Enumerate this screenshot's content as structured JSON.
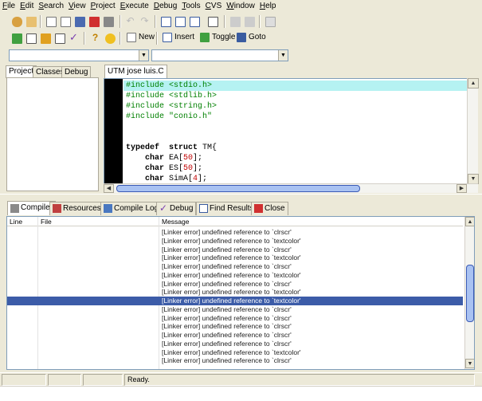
{
  "menu": [
    {
      "key": "F",
      "rest": "ile"
    },
    {
      "key": "E",
      "rest": "dit"
    },
    {
      "key": "S",
      "rest": "earch"
    },
    {
      "key": "V",
      "rest": "iew"
    },
    {
      "key": "P",
      "rest": "roject"
    },
    {
      "key": "E",
      "rest": "xecute"
    },
    {
      "key": "D",
      "rest": "ebug"
    },
    {
      "key": "T",
      "rest": "ools"
    },
    {
      "key": "C",
      "rest": "VS"
    },
    {
      "key": "W",
      "rest": "indow"
    },
    {
      "key": "H",
      "rest": "elp"
    }
  ],
  "toolbar2": {
    "new": "New",
    "insert": "Insert",
    "toggle": "Toggle",
    "goto": "Goto"
  },
  "left_tabs": [
    "Project",
    "Classes",
    "Debug"
  ],
  "editor_tab": "UTM jose luis.C",
  "code_lines": [
    {
      "type": "hl",
      "kw": "#include",
      "arg": " <stdio.h>"
    },
    {
      "type": "inc",
      "kw": "#include",
      "arg": " <stdlib.h>"
    },
    {
      "type": "inc",
      "kw": "#include",
      "arg": " <string.h>"
    },
    {
      "type": "inc",
      "kw": "#include",
      "arg": " \"conio.h\""
    },
    {
      "type": "blank"
    },
    {
      "type": "blank"
    },
    {
      "type": "decl",
      "a": "typedef",
      "b": "  struct",
      "c": " TM{"
    },
    {
      "type": "field",
      "a": "    char",
      "name": " EA[",
      "num": "50",
      "end": "];"
    },
    {
      "type": "field",
      "a": "    char",
      "name": " ES[",
      "num": "50",
      "end": "];"
    },
    {
      "type": "field",
      "a": "    char",
      "name": " SimA[",
      "num": "4",
      "end": "];"
    }
  ],
  "bottom_tabs": [
    "Compiler",
    "Resources",
    "Compile Log",
    "Debug",
    "Find Results",
    "Close"
  ],
  "msg_headers": {
    "line": "Line",
    "file": "File",
    "message": "Message"
  },
  "messages": [
    "[Linker error] undefined reference to `clrscr'",
    "[Linker error] undefined reference to `textcolor'",
    "[Linker error] undefined reference to `clrscr'",
    "[Linker error] undefined reference to `textcolor'",
    "[Linker error] undefined reference to `clrscr'",
    "[Linker error] undefined reference to `textcolor'",
    "[Linker error] undefined reference to `clrscr'",
    "[Linker error] undefined reference to `textcolor'",
    "[Linker error] undefined reference to `textcolor'",
    "[Linker error] undefined reference to `clrscr'",
    "[Linker error] undefined reference to `clrscr'",
    "[Linker error] undefined reference to `clrscr'",
    "[Linker error] undefined reference to `clrscr'",
    "[Linker error] undefined reference to `clrscr'",
    "[Linker error] undefined reference to `textcolor'",
    "[Linker error] undefined reference to `clrscr'"
  ],
  "selected_index": 8,
  "status": "Ready.",
  "colors": {
    "highlight_line": "#b5f2f2",
    "selection": "#3c5ca8"
  }
}
